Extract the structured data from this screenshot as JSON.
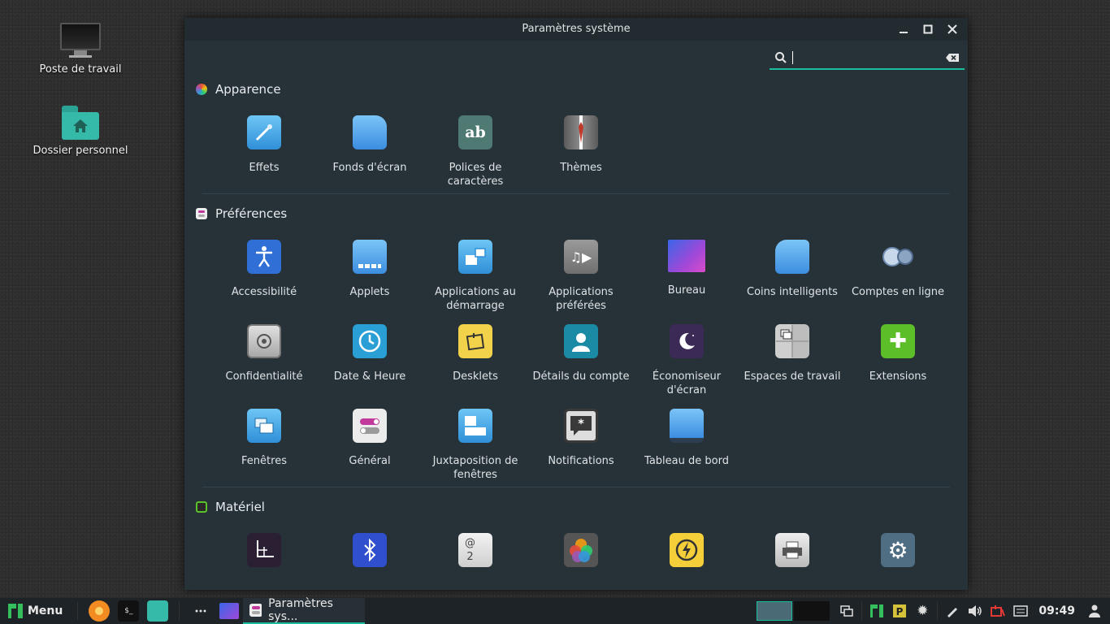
{
  "desktop": {
    "icons": [
      {
        "label": "Poste de travail"
      },
      {
        "label": "Dossier personnel"
      }
    ]
  },
  "window": {
    "title": "Paramètres système",
    "search": {
      "value": "",
      "placeholder": ""
    }
  },
  "sections": [
    {
      "title": "Apparence",
      "items": [
        {
          "label": "Effets"
        },
        {
          "label": "Fonds d'écran"
        },
        {
          "label": "Polices de caractères"
        },
        {
          "label": "Thèmes"
        }
      ]
    },
    {
      "title": "Préférences",
      "items": [
        {
          "label": "Accessibilité"
        },
        {
          "label": "Applets"
        },
        {
          "label": "Applications au démarrage"
        },
        {
          "label": "Applications préférées"
        },
        {
          "label": "Bureau"
        },
        {
          "label": "Coins intelligents"
        },
        {
          "label": "Comptes en ligne"
        },
        {
          "label": "Confidentialité"
        },
        {
          "label": "Date & Heure"
        },
        {
          "label": "Desklets"
        },
        {
          "label": "Détails du compte"
        },
        {
          "label": "Économiseur d'écran"
        },
        {
          "label": "Espaces de travail"
        },
        {
          "label": "Extensions"
        },
        {
          "label": "Fenêtres"
        },
        {
          "label": "Général"
        },
        {
          "label": "Juxtaposition de fenêtres"
        },
        {
          "label": "Notifications"
        },
        {
          "label": "Tableau de bord"
        }
      ]
    },
    {
      "title": "Matériel",
      "items": [
        {
          "label": ""
        },
        {
          "label": ""
        },
        {
          "label": ""
        },
        {
          "label": ""
        },
        {
          "label": ""
        },
        {
          "label": ""
        },
        {
          "label": ""
        }
      ]
    }
  ],
  "taskbar": {
    "menu_label": "Menu",
    "task_label": "Paramètres sys...",
    "clock": "09:49"
  },
  "colors": {
    "accent": "#1abc9c",
    "window_bg": "#263238",
    "titlebar_bg": "#222b30",
    "taskbar_bg": "#1d2326"
  }
}
